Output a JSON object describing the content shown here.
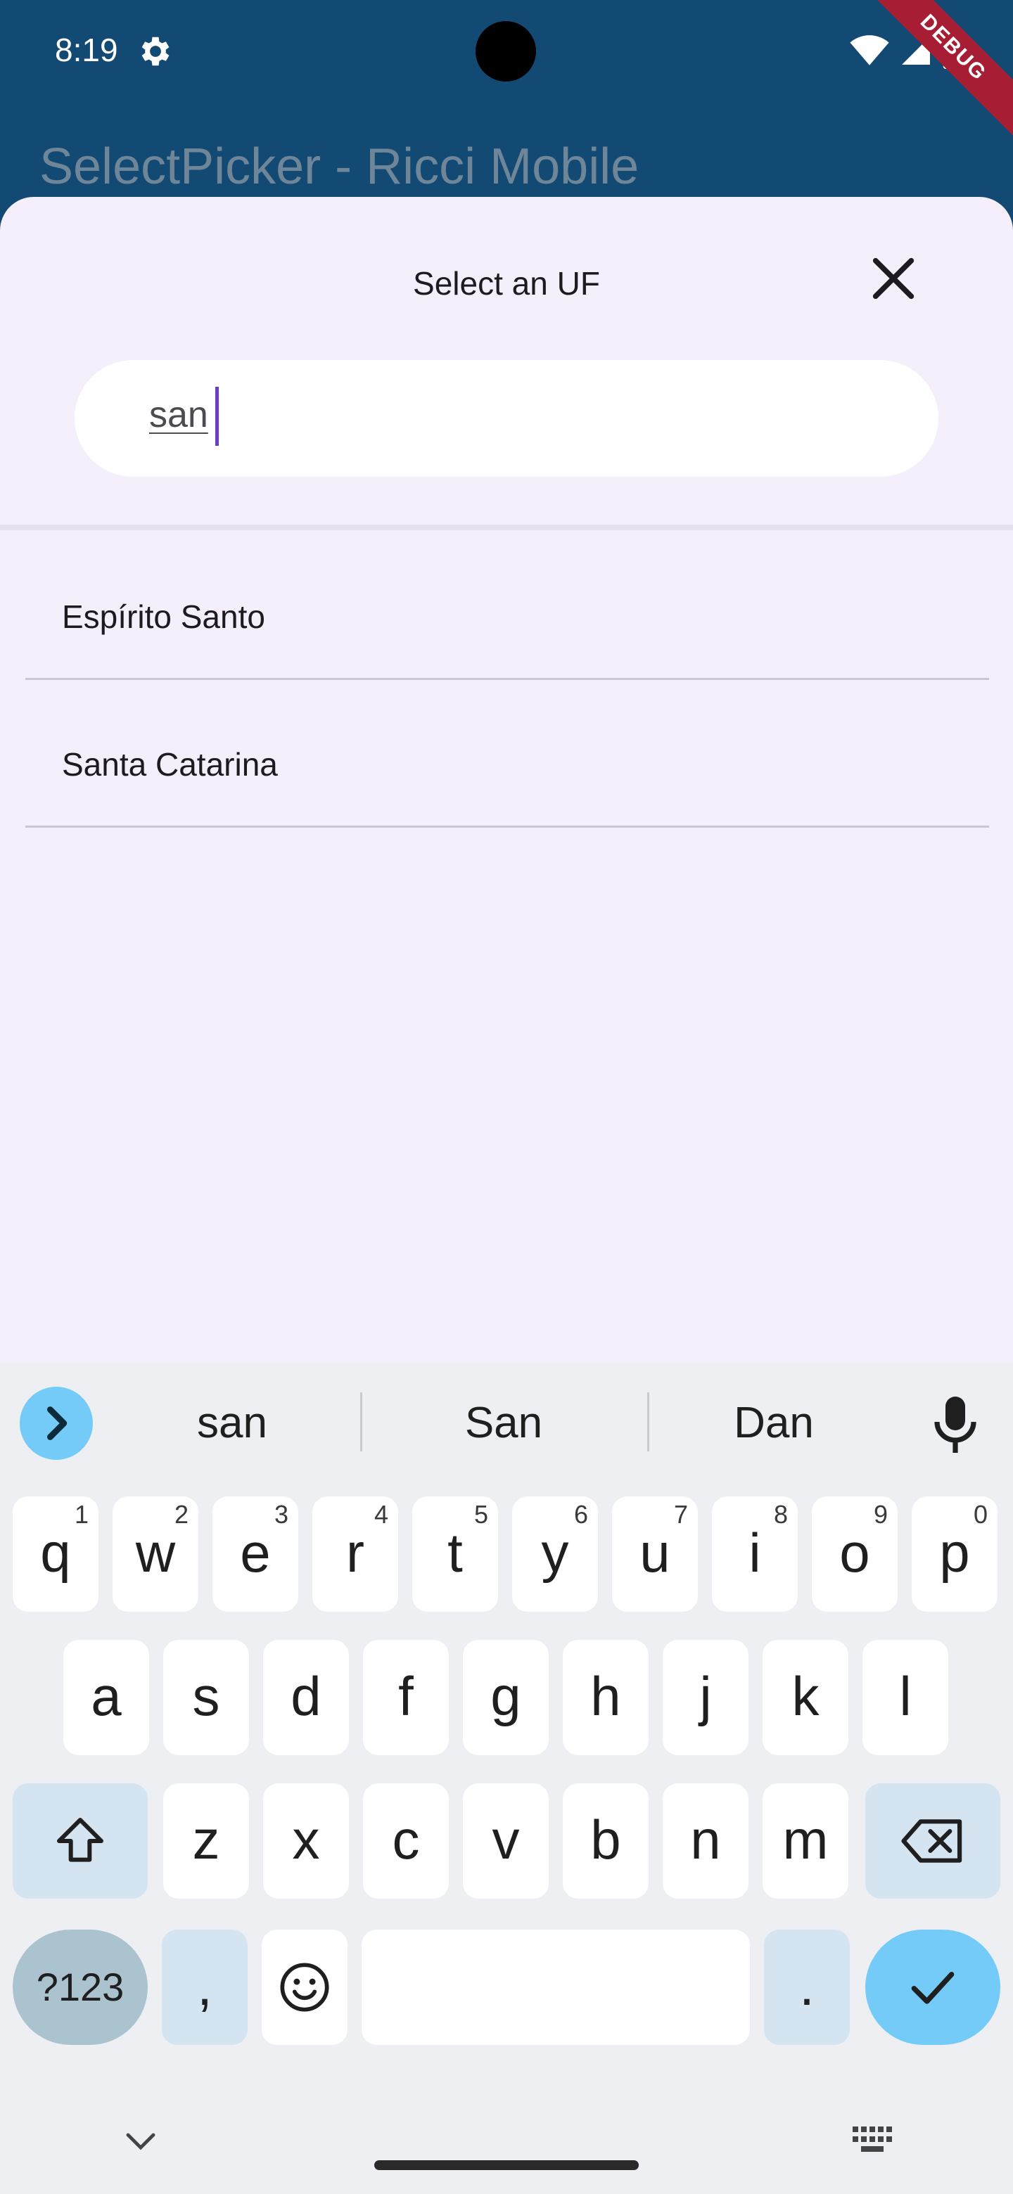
{
  "status_bar": {
    "time": "8:19",
    "icons": [
      "settings-gear-icon",
      "wifi-icon",
      "signal-icon",
      "battery-icon"
    ]
  },
  "app_bar": {
    "title": "SelectPicker - Ricci Mobile",
    "debug_banner": "DEBUG"
  },
  "picker": {
    "title": "Select an UF",
    "search_value": "san",
    "results": [
      "Espírito Santo",
      "Santa Catarina"
    ]
  },
  "keyboard": {
    "suggestions": [
      "san",
      "San",
      "Dan"
    ],
    "rows": [
      [
        {
          "label": "q",
          "hint": "1"
        },
        {
          "label": "w",
          "hint": "2"
        },
        {
          "label": "e",
          "hint": "3"
        },
        {
          "label": "r",
          "hint": "4"
        },
        {
          "label": "t",
          "hint": "5"
        },
        {
          "label": "y",
          "hint": "6"
        },
        {
          "label": "u",
          "hint": "7"
        },
        {
          "label": "i",
          "hint": "8"
        },
        {
          "label": "o",
          "hint": "9"
        },
        {
          "label": "p",
          "hint": "0"
        }
      ],
      [
        {
          "label": "a"
        },
        {
          "label": "s"
        },
        {
          "label": "d"
        },
        {
          "label": "f"
        },
        {
          "label": "g"
        },
        {
          "label": "h"
        },
        {
          "label": "j"
        },
        {
          "label": "k"
        },
        {
          "label": "l"
        }
      ],
      [
        {
          "label": "z"
        },
        {
          "label": "x"
        },
        {
          "label": "c"
        },
        {
          "label": "v"
        },
        {
          "label": "b"
        },
        {
          "label": "n"
        },
        {
          "label": "m"
        }
      ]
    ],
    "mode_key": "?123",
    "comma_key": ",",
    "period_key": "."
  },
  "colors": {
    "app_bar": "#124a74",
    "sheet": "#f4effa",
    "cursor": "#6a3fc4",
    "accent_key": "#74cbf8",
    "debug": "#a71e34"
  }
}
